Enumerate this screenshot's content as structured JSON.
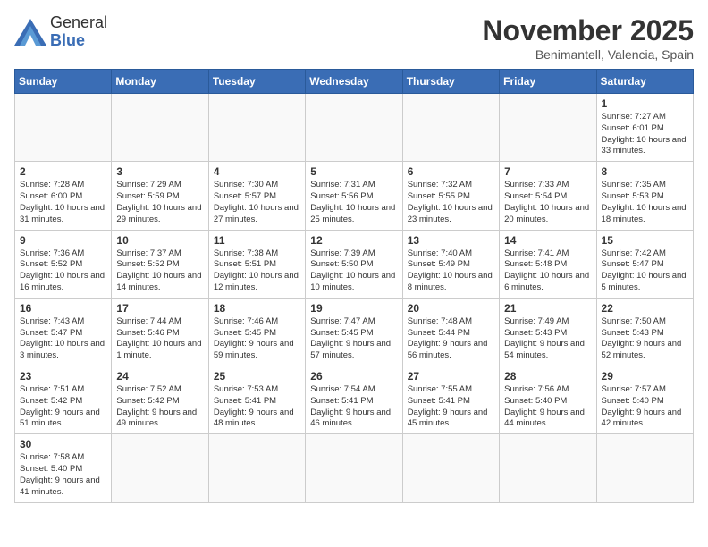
{
  "header": {
    "logo_general": "General",
    "logo_blue": "Blue",
    "month_title": "November 2025",
    "location": "Benimantell, Valencia, Spain"
  },
  "days_of_week": [
    "Sunday",
    "Monday",
    "Tuesday",
    "Wednesday",
    "Thursday",
    "Friday",
    "Saturday"
  ],
  "weeks": [
    [
      {
        "num": "",
        "info": ""
      },
      {
        "num": "",
        "info": ""
      },
      {
        "num": "",
        "info": ""
      },
      {
        "num": "",
        "info": ""
      },
      {
        "num": "",
        "info": ""
      },
      {
        "num": "",
        "info": ""
      },
      {
        "num": "1",
        "info": "Sunrise: 7:27 AM\nSunset: 6:01 PM\nDaylight: 10 hours\nand 33 minutes."
      }
    ],
    [
      {
        "num": "2",
        "info": "Sunrise: 7:28 AM\nSunset: 6:00 PM\nDaylight: 10 hours\nand 31 minutes."
      },
      {
        "num": "3",
        "info": "Sunrise: 7:29 AM\nSunset: 5:59 PM\nDaylight: 10 hours\nand 29 minutes."
      },
      {
        "num": "4",
        "info": "Sunrise: 7:30 AM\nSunset: 5:57 PM\nDaylight: 10 hours\nand 27 minutes."
      },
      {
        "num": "5",
        "info": "Sunrise: 7:31 AM\nSunset: 5:56 PM\nDaylight: 10 hours\nand 25 minutes."
      },
      {
        "num": "6",
        "info": "Sunrise: 7:32 AM\nSunset: 5:55 PM\nDaylight: 10 hours\nand 23 minutes."
      },
      {
        "num": "7",
        "info": "Sunrise: 7:33 AM\nSunset: 5:54 PM\nDaylight: 10 hours\nand 20 minutes."
      },
      {
        "num": "8",
        "info": "Sunrise: 7:35 AM\nSunset: 5:53 PM\nDaylight: 10 hours\nand 18 minutes."
      }
    ],
    [
      {
        "num": "9",
        "info": "Sunrise: 7:36 AM\nSunset: 5:52 PM\nDaylight: 10 hours\nand 16 minutes."
      },
      {
        "num": "10",
        "info": "Sunrise: 7:37 AM\nSunset: 5:52 PM\nDaylight: 10 hours\nand 14 minutes."
      },
      {
        "num": "11",
        "info": "Sunrise: 7:38 AM\nSunset: 5:51 PM\nDaylight: 10 hours\nand 12 minutes."
      },
      {
        "num": "12",
        "info": "Sunrise: 7:39 AM\nSunset: 5:50 PM\nDaylight: 10 hours\nand 10 minutes."
      },
      {
        "num": "13",
        "info": "Sunrise: 7:40 AM\nSunset: 5:49 PM\nDaylight: 10 hours\nand 8 minutes."
      },
      {
        "num": "14",
        "info": "Sunrise: 7:41 AM\nSunset: 5:48 PM\nDaylight: 10 hours\nand 6 minutes."
      },
      {
        "num": "15",
        "info": "Sunrise: 7:42 AM\nSunset: 5:47 PM\nDaylight: 10 hours\nand 5 minutes."
      }
    ],
    [
      {
        "num": "16",
        "info": "Sunrise: 7:43 AM\nSunset: 5:47 PM\nDaylight: 10 hours\nand 3 minutes."
      },
      {
        "num": "17",
        "info": "Sunrise: 7:44 AM\nSunset: 5:46 PM\nDaylight: 10 hours\nand 1 minute."
      },
      {
        "num": "18",
        "info": "Sunrise: 7:46 AM\nSunset: 5:45 PM\nDaylight: 9 hours\nand 59 minutes."
      },
      {
        "num": "19",
        "info": "Sunrise: 7:47 AM\nSunset: 5:45 PM\nDaylight: 9 hours\nand 57 minutes."
      },
      {
        "num": "20",
        "info": "Sunrise: 7:48 AM\nSunset: 5:44 PM\nDaylight: 9 hours\nand 56 minutes."
      },
      {
        "num": "21",
        "info": "Sunrise: 7:49 AM\nSunset: 5:43 PM\nDaylight: 9 hours\nand 54 minutes."
      },
      {
        "num": "22",
        "info": "Sunrise: 7:50 AM\nSunset: 5:43 PM\nDaylight: 9 hours\nand 52 minutes."
      }
    ],
    [
      {
        "num": "23",
        "info": "Sunrise: 7:51 AM\nSunset: 5:42 PM\nDaylight: 9 hours\nand 51 minutes."
      },
      {
        "num": "24",
        "info": "Sunrise: 7:52 AM\nSunset: 5:42 PM\nDaylight: 9 hours\nand 49 minutes."
      },
      {
        "num": "25",
        "info": "Sunrise: 7:53 AM\nSunset: 5:41 PM\nDaylight: 9 hours\nand 48 minutes."
      },
      {
        "num": "26",
        "info": "Sunrise: 7:54 AM\nSunset: 5:41 PM\nDaylight: 9 hours\nand 46 minutes."
      },
      {
        "num": "27",
        "info": "Sunrise: 7:55 AM\nSunset: 5:41 PM\nDaylight: 9 hours\nand 45 minutes."
      },
      {
        "num": "28",
        "info": "Sunrise: 7:56 AM\nSunset: 5:40 PM\nDaylight: 9 hours\nand 44 minutes."
      },
      {
        "num": "29",
        "info": "Sunrise: 7:57 AM\nSunset: 5:40 PM\nDaylight: 9 hours\nand 42 minutes."
      }
    ],
    [
      {
        "num": "30",
        "info": "Sunrise: 7:58 AM\nSunset: 5:40 PM\nDaylight: 9 hours\nand 41 minutes."
      },
      {
        "num": "",
        "info": ""
      },
      {
        "num": "",
        "info": ""
      },
      {
        "num": "",
        "info": ""
      },
      {
        "num": "",
        "info": ""
      },
      {
        "num": "",
        "info": ""
      },
      {
        "num": "",
        "info": ""
      }
    ]
  ]
}
